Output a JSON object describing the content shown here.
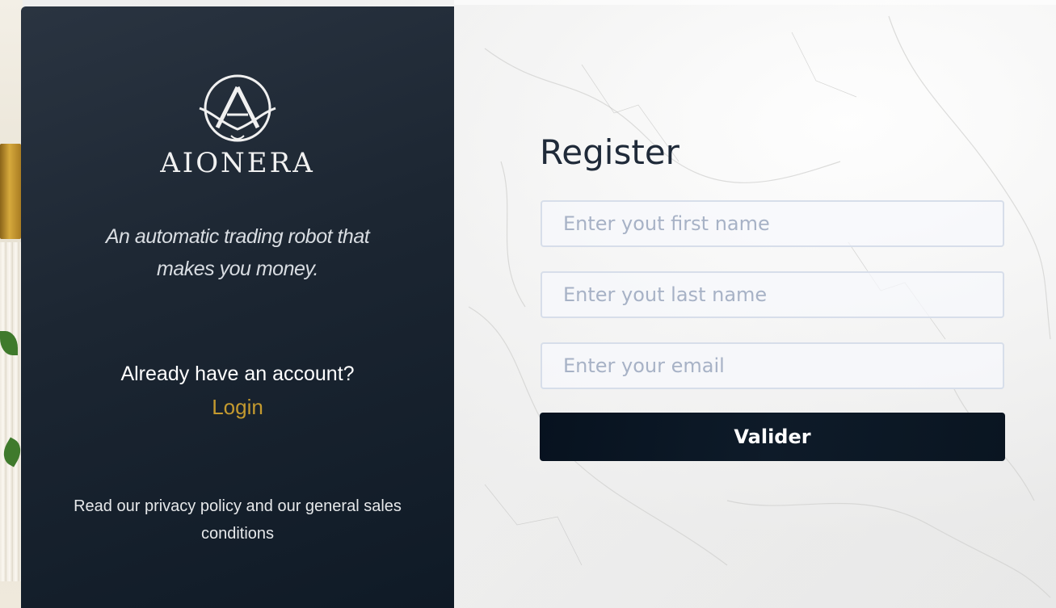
{
  "brand": {
    "name": "AIONERA",
    "logo_icon": "aionera-crest-icon"
  },
  "left_panel": {
    "tagline_line1": "An automatic trading robot that",
    "tagline_line2": "makes you money.",
    "account_question": "Already have an account?",
    "login_label": "Login",
    "policy_line1": "Read our privacy policy and our general sales",
    "policy_line2": "conditions"
  },
  "form": {
    "title": "Register",
    "first_name_placeholder": "Enter yout first name",
    "last_name_placeholder": "Enter yout last name",
    "email_placeholder": "Enter your email",
    "submit_label": "Valider"
  },
  "colors": {
    "panel_dark": "#1c2632",
    "accent_gold": "#c49a2f",
    "button_dark": "#0a1521",
    "title_dark": "#1f2a39"
  }
}
